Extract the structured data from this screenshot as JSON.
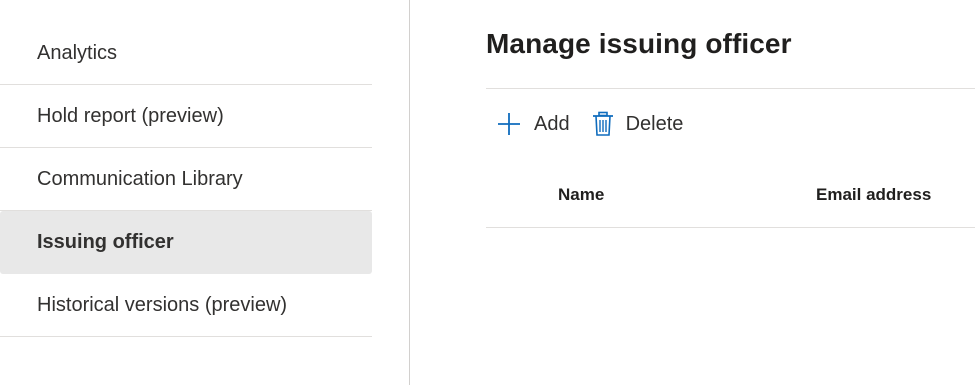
{
  "nav": {
    "items": [
      {
        "label": "Analytics"
      },
      {
        "label": "Hold report (preview)"
      },
      {
        "label": "Communication Library"
      },
      {
        "label": "Issuing officer"
      },
      {
        "label": "Historical versions (preview)"
      }
    ],
    "selected": "Issuing officer"
  },
  "main": {
    "title": "Manage issuing officer",
    "toolbar": {
      "add_label": "Add",
      "delete_label": "Delete",
      "add_icon": "plus-icon",
      "delete_icon": "trash-icon"
    },
    "table": {
      "columns": [
        "Name",
        "Email address"
      ]
    }
  },
  "colors": {
    "accent": "#0f6cbd",
    "selected_bg": "#e8e8e8",
    "divider": "#e1dfdd"
  }
}
